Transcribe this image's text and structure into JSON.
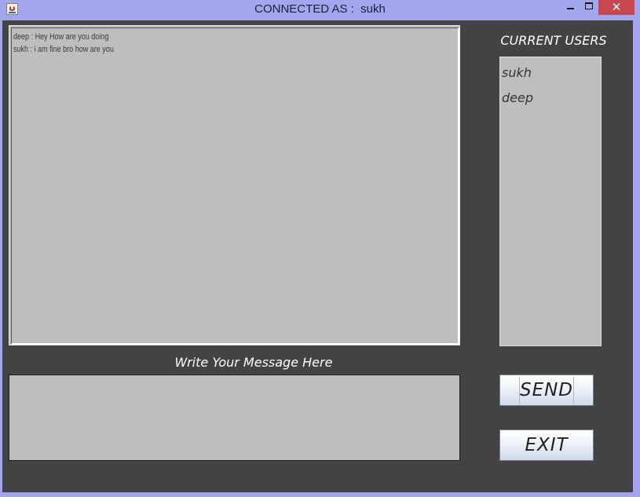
{
  "window": {
    "title": "CONNECTED AS :  sukh",
    "close_glyph": "✕"
  },
  "chat": {
    "messages": [
      "deep : Hey How are you doing",
      "sukh : i am fine bro how are you"
    ]
  },
  "users": {
    "title": "CURRENT USERS",
    "items": [
      "sukh",
      "deep"
    ]
  },
  "compose": {
    "label": "Write Your Message Here",
    "value": "",
    "send_label": "SEND",
    "exit_label": "EXIT"
  },
  "colors": {
    "titlebar": "#a3a6ec",
    "panel": "#434343",
    "field": "#bebebe",
    "close": "#c7494f"
  }
}
